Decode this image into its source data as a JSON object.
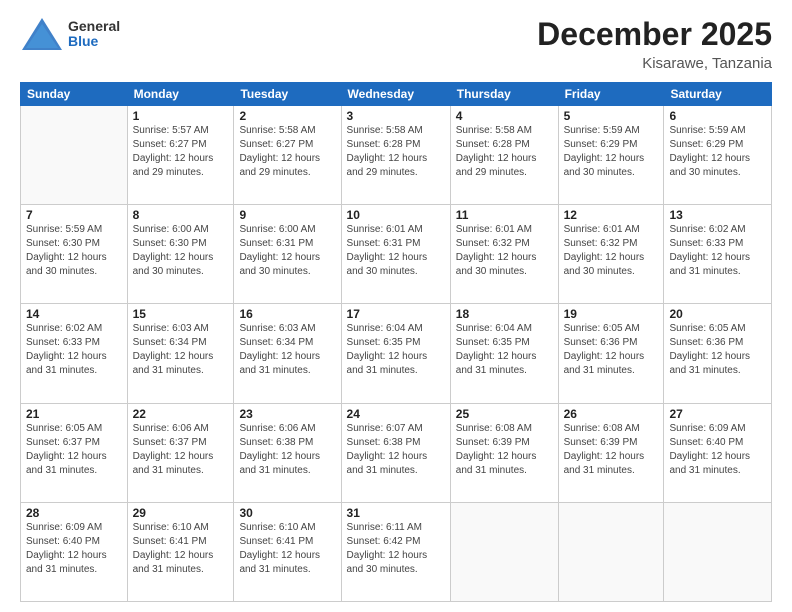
{
  "logo": {
    "general": "General",
    "blue": "Blue"
  },
  "header": {
    "month": "December 2025",
    "location": "Kisarawe, Tanzania"
  },
  "weekdays": [
    "Sunday",
    "Monday",
    "Tuesday",
    "Wednesday",
    "Thursday",
    "Friday",
    "Saturday"
  ],
  "weeks": [
    [
      {
        "day": "",
        "info": ""
      },
      {
        "day": "1",
        "info": "Sunrise: 5:57 AM\nSunset: 6:27 PM\nDaylight: 12 hours\nand 29 minutes."
      },
      {
        "day": "2",
        "info": "Sunrise: 5:58 AM\nSunset: 6:27 PM\nDaylight: 12 hours\nand 29 minutes."
      },
      {
        "day": "3",
        "info": "Sunrise: 5:58 AM\nSunset: 6:28 PM\nDaylight: 12 hours\nand 29 minutes."
      },
      {
        "day": "4",
        "info": "Sunrise: 5:58 AM\nSunset: 6:28 PM\nDaylight: 12 hours\nand 29 minutes."
      },
      {
        "day": "5",
        "info": "Sunrise: 5:59 AM\nSunset: 6:29 PM\nDaylight: 12 hours\nand 30 minutes."
      },
      {
        "day": "6",
        "info": "Sunrise: 5:59 AM\nSunset: 6:29 PM\nDaylight: 12 hours\nand 30 minutes."
      }
    ],
    [
      {
        "day": "7",
        "info": "Sunrise: 5:59 AM\nSunset: 6:30 PM\nDaylight: 12 hours\nand 30 minutes."
      },
      {
        "day": "8",
        "info": "Sunrise: 6:00 AM\nSunset: 6:30 PM\nDaylight: 12 hours\nand 30 minutes."
      },
      {
        "day": "9",
        "info": "Sunrise: 6:00 AM\nSunset: 6:31 PM\nDaylight: 12 hours\nand 30 minutes."
      },
      {
        "day": "10",
        "info": "Sunrise: 6:01 AM\nSunset: 6:31 PM\nDaylight: 12 hours\nand 30 minutes."
      },
      {
        "day": "11",
        "info": "Sunrise: 6:01 AM\nSunset: 6:32 PM\nDaylight: 12 hours\nand 30 minutes."
      },
      {
        "day": "12",
        "info": "Sunrise: 6:01 AM\nSunset: 6:32 PM\nDaylight: 12 hours\nand 30 minutes."
      },
      {
        "day": "13",
        "info": "Sunrise: 6:02 AM\nSunset: 6:33 PM\nDaylight: 12 hours\nand 31 minutes."
      }
    ],
    [
      {
        "day": "14",
        "info": "Sunrise: 6:02 AM\nSunset: 6:33 PM\nDaylight: 12 hours\nand 31 minutes."
      },
      {
        "day": "15",
        "info": "Sunrise: 6:03 AM\nSunset: 6:34 PM\nDaylight: 12 hours\nand 31 minutes."
      },
      {
        "day": "16",
        "info": "Sunrise: 6:03 AM\nSunset: 6:34 PM\nDaylight: 12 hours\nand 31 minutes."
      },
      {
        "day": "17",
        "info": "Sunrise: 6:04 AM\nSunset: 6:35 PM\nDaylight: 12 hours\nand 31 minutes."
      },
      {
        "day": "18",
        "info": "Sunrise: 6:04 AM\nSunset: 6:35 PM\nDaylight: 12 hours\nand 31 minutes."
      },
      {
        "day": "19",
        "info": "Sunrise: 6:05 AM\nSunset: 6:36 PM\nDaylight: 12 hours\nand 31 minutes."
      },
      {
        "day": "20",
        "info": "Sunrise: 6:05 AM\nSunset: 6:36 PM\nDaylight: 12 hours\nand 31 minutes."
      }
    ],
    [
      {
        "day": "21",
        "info": "Sunrise: 6:05 AM\nSunset: 6:37 PM\nDaylight: 12 hours\nand 31 minutes."
      },
      {
        "day": "22",
        "info": "Sunrise: 6:06 AM\nSunset: 6:37 PM\nDaylight: 12 hours\nand 31 minutes."
      },
      {
        "day": "23",
        "info": "Sunrise: 6:06 AM\nSunset: 6:38 PM\nDaylight: 12 hours\nand 31 minutes."
      },
      {
        "day": "24",
        "info": "Sunrise: 6:07 AM\nSunset: 6:38 PM\nDaylight: 12 hours\nand 31 minutes."
      },
      {
        "day": "25",
        "info": "Sunrise: 6:08 AM\nSunset: 6:39 PM\nDaylight: 12 hours\nand 31 minutes."
      },
      {
        "day": "26",
        "info": "Sunrise: 6:08 AM\nSunset: 6:39 PM\nDaylight: 12 hours\nand 31 minutes."
      },
      {
        "day": "27",
        "info": "Sunrise: 6:09 AM\nSunset: 6:40 PM\nDaylight: 12 hours\nand 31 minutes."
      }
    ],
    [
      {
        "day": "28",
        "info": "Sunrise: 6:09 AM\nSunset: 6:40 PM\nDaylight: 12 hours\nand 31 minutes."
      },
      {
        "day": "29",
        "info": "Sunrise: 6:10 AM\nSunset: 6:41 PM\nDaylight: 12 hours\nand 31 minutes."
      },
      {
        "day": "30",
        "info": "Sunrise: 6:10 AM\nSunset: 6:41 PM\nDaylight: 12 hours\nand 31 minutes."
      },
      {
        "day": "31",
        "info": "Sunrise: 6:11 AM\nSunset: 6:42 PM\nDaylight: 12 hours\nand 30 minutes."
      },
      {
        "day": "",
        "info": ""
      },
      {
        "day": "",
        "info": ""
      },
      {
        "day": "",
        "info": ""
      }
    ]
  ]
}
